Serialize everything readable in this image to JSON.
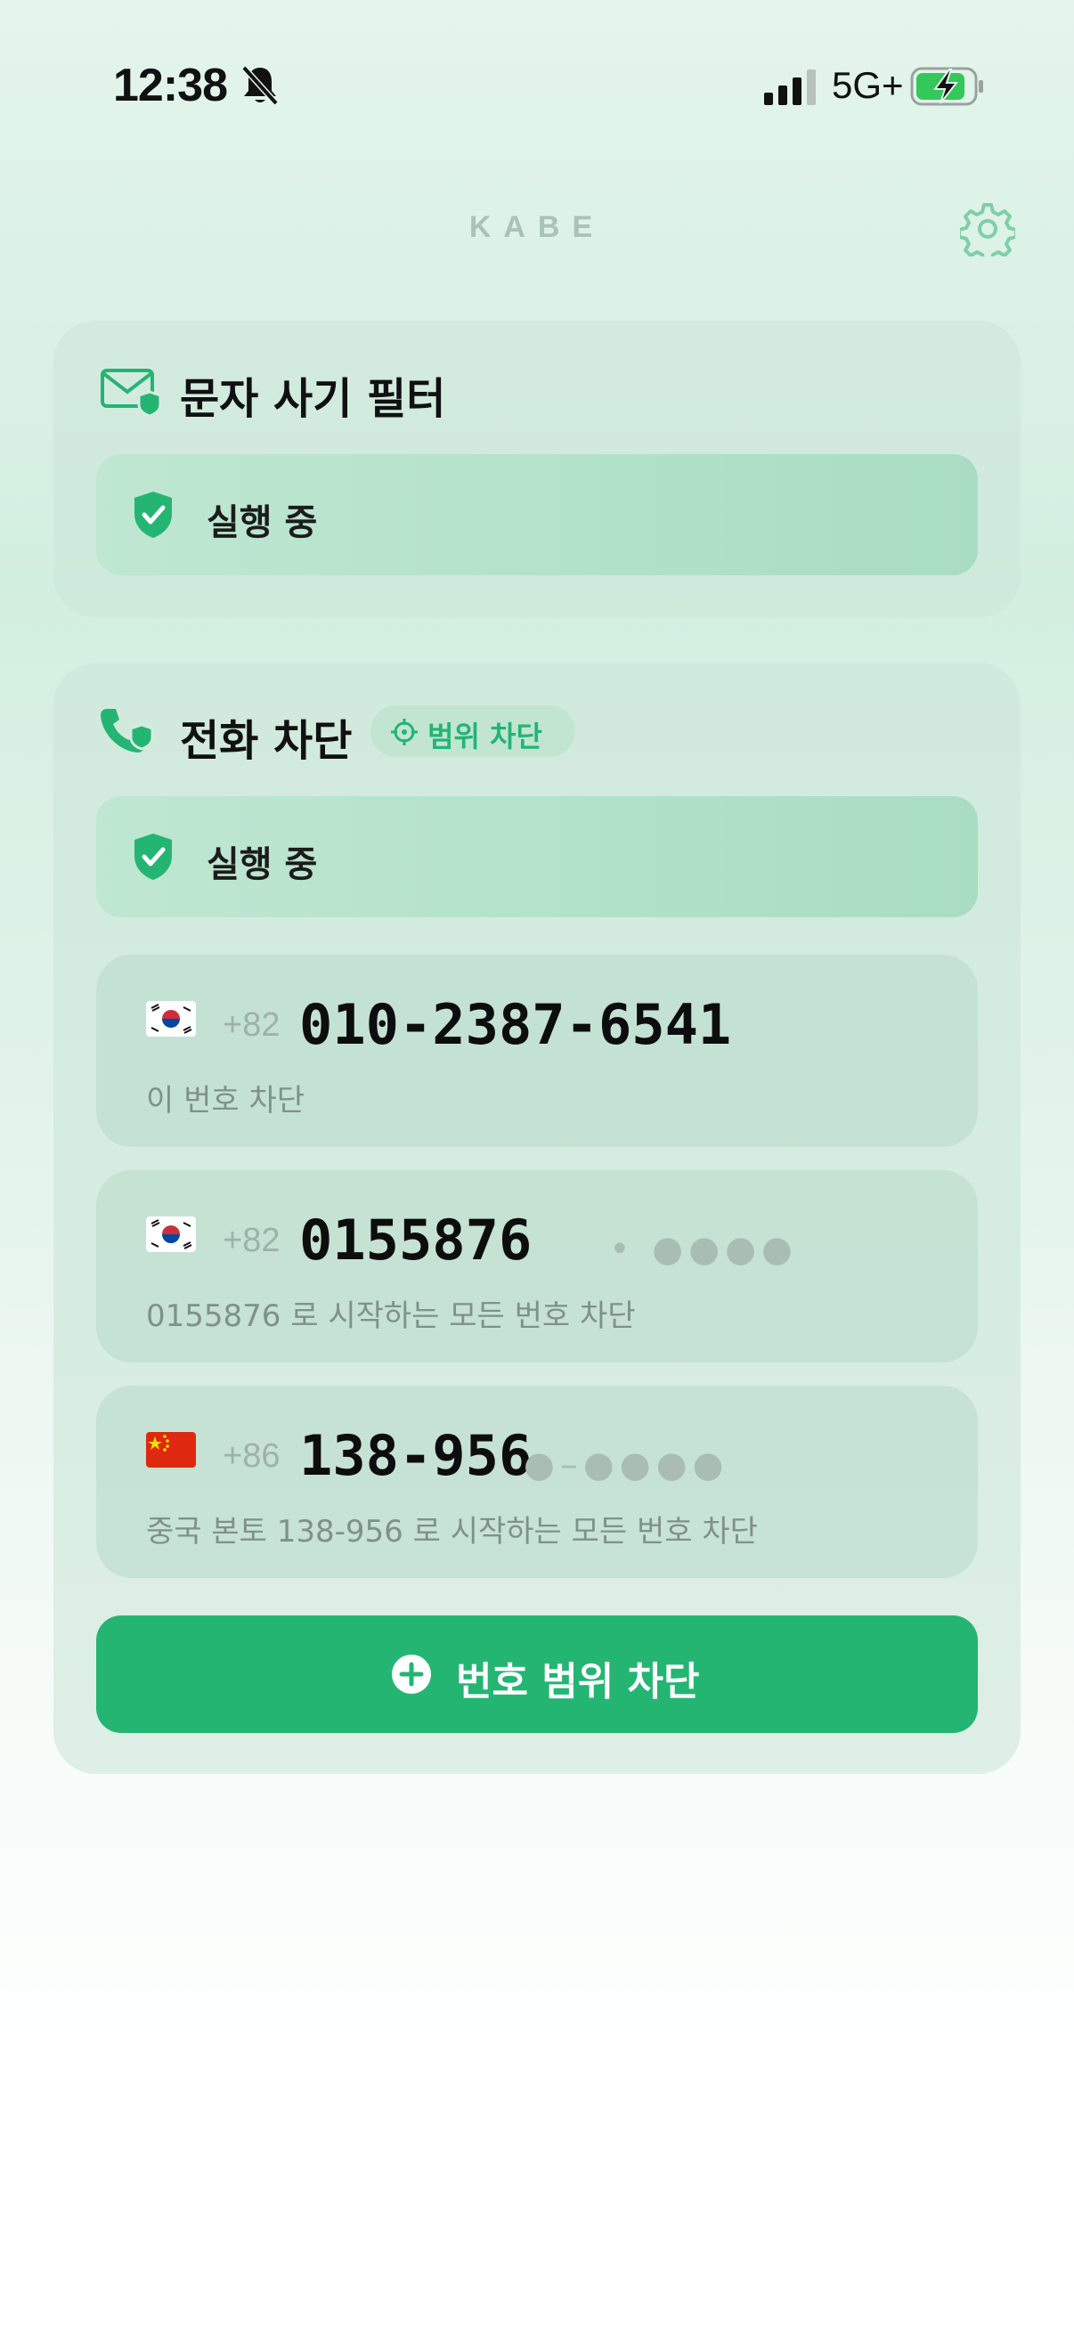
{
  "status_bar": {
    "time": "12:38",
    "network": "5G+"
  },
  "app": {
    "brand": "KABE"
  },
  "sms_filter": {
    "title": "문자 사기 필터",
    "status": "실행 중"
  },
  "call_block": {
    "title": "전화 차단",
    "badge": "범위 차단",
    "status": "실행 중",
    "numbers": [
      {
        "country_code": "+82",
        "number": "010-2387-6541",
        "mask": "",
        "description": "이 번호 차단"
      },
      {
        "country_code": "+82",
        "number": "0155876",
        "mask": "• ●●●●",
        "description": "0155876 로 시작하는 모든 번호 차단"
      },
      {
        "country_code": "+86",
        "number": "138-956",
        "mask": "●–●●●●",
        "description": "중국 본토 138-956 로 시작하는 모든 번호 차단"
      }
    ],
    "add_button": "번호 범위 차단"
  },
  "colors": {
    "accent": "#24b573",
    "card_bg": "#cde7da",
    "running_bg": "#b4e1ca"
  },
  "icons": [
    "bell-slash-icon",
    "signal-icon",
    "battery-charging-icon",
    "gear-icon",
    "mail-shield-icon",
    "phone-shield-icon",
    "shield-check-icon",
    "crosshair-icon",
    "flag-korea-icon",
    "flag-china-icon",
    "plus-circle-icon"
  ]
}
